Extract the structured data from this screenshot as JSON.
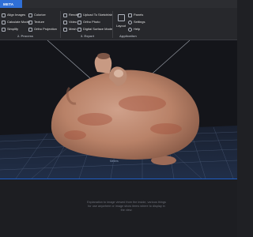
{
  "app": {
    "tab_label": "META"
  },
  "ribbon": {
    "process": {
      "title": "2. Process",
      "items": [
        {
          "label": "Align Images",
          "icon": "images-icon"
        },
        {
          "label": "Calculate Model",
          "icon": "cube-icon"
        },
        {
          "label": "Simplify",
          "icon": "simplify-icon"
        },
        {
          "label": "Colorize",
          "icon": "colorize-icon"
        },
        {
          "label": "Texture",
          "icon": "texture-icon"
        },
        {
          "label": "Ortho Projection",
          "icon": "projection-icon"
        }
      ]
    },
    "export": {
      "title": "3. Export",
      "items": [
        {
          "label": "Render",
          "icon": "render-icon"
        },
        {
          "label": "Video",
          "icon": "video-icon"
        },
        {
          "label": "Mesh",
          "icon": "mesh-icon"
        },
        {
          "label": "Upload To Sketchfab",
          "icon": "upload-icon"
        },
        {
          "label": "Ortho Photo",
          "icon": "photo-icon"
        },
        {
          "label": "Digital Surface Model",
          "icon": "dsm-icon"
        }
      ]
    },
    "application": {
      "title": "Application",
      "layout_label": "Layout",
      "items": [
        {
          "label": "Panels",
          "icon": "panels-icon"
        },
        {
          "label": "Settings",
          "icon": "settings-icon"
        },
        {
          "label": "Help",
          "icon": "help-icon"
        }
      ]
    }
  },
  "viewport": {
    "ground_label": "Meters",
    "colors": {
      "background": "#14151a",
      "grid": "#5a6c8c",
      "object": "#b98268"
    }
  },
  "panel": {
    "hint": "Explanation to image viewed from the inside, various things for use anywhere or image show items where to display in the view."
  }
}
